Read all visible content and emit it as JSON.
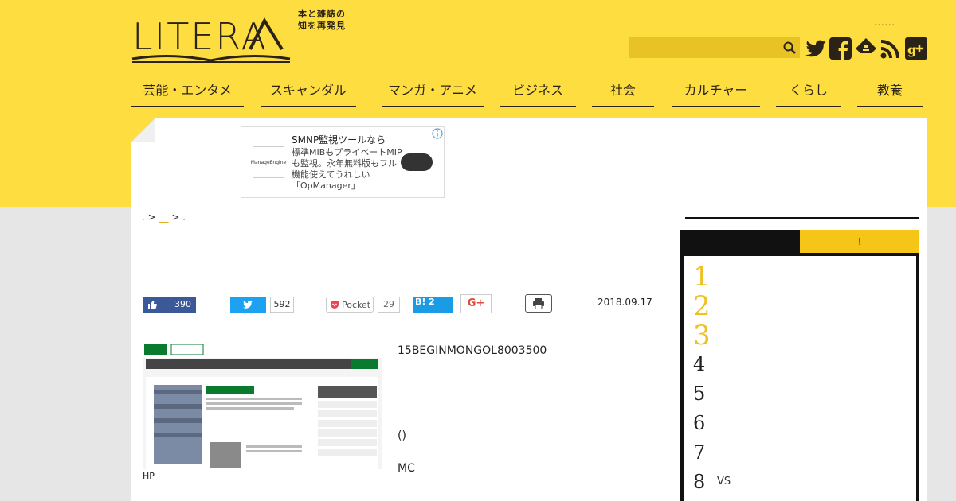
{
  "header": {
    "logo_text": "LITERA",
    "tagline_1": "本と雑誌の",
    "tagline_2": "知を再発見",
    "dots": "......",
    "search": {
      "placeholder": ""
    }
  },
  "social": [
    "twitter-icon",
    "facebook-icon",
    "feedly-icon",
    "rss-icon",
    "google-plus-icon"
  ],
  "nav": {
    "items": [
      {
        "label": "芸能・エンタメ"
      },
      {
        "label": "スキャンダル"
      },
      {
        "label": "マンガ・アニメ"
      },
      {
        "label": "ビジネス"
      },
      {
        "label": "社会"
      },
      {
        "label": "カルチャー"
      },
      {
        "label": "くらし"
      },
      {
        "label": "教養"
      }
    ]
  },
  "ad": {
    "brand": "ManageEngine",
    "title": "SMNP監視ツールなら",
    "body": "標準MIBもプライベートMIPも監視。永年無料版もフル機能使えてうれしい「OpManager」"
  },
  "breadcrumb": {
    "home": ".",
    "sep1": " > ",
    "cat": "__",
    "sep2": " > ",
    "current": "."
  },
  "share": {
    "facebook_count": "390",
    "twitter_count": "592",
    "pocket_label": "Pocket",
    "pocket_count": "29",
    "hatena_label": "B!",
    "hatena_count": "2",
    "gplus_label": "G+"
  },
  "article": {
    "date": "2018.09.17",
    "image_caption": "HP",
    "para1": "15BEGINMONGOL8003500",
    "para2": "()",
    "para3": "MC"
  },
  "sidebar": {
    "tab_active": "",
    "tab_other": "!",
    "ranking": [
      {
        "num": "1",
        "text": ""
      },
      {
        "num": "2",
        "text": ""
      },
      {
        "num": "3",
        "text": ""
      },
      {
        "num": "4",
        "text": ""
      },
      {
        "num": "5",
        "text": ""
      },
      {
        "num": "6",
        "text": ""
      },
      {
        "num": "7",
        "text": ""
      },
      {
        "num": "8",
        "text": "VS"
      }
    ]
  },
  "colors": {
    "brand_yellow": "#fddd40",
    "dark": "#2b2218",
    "rank_gold": "#f0c020"
  }
}
